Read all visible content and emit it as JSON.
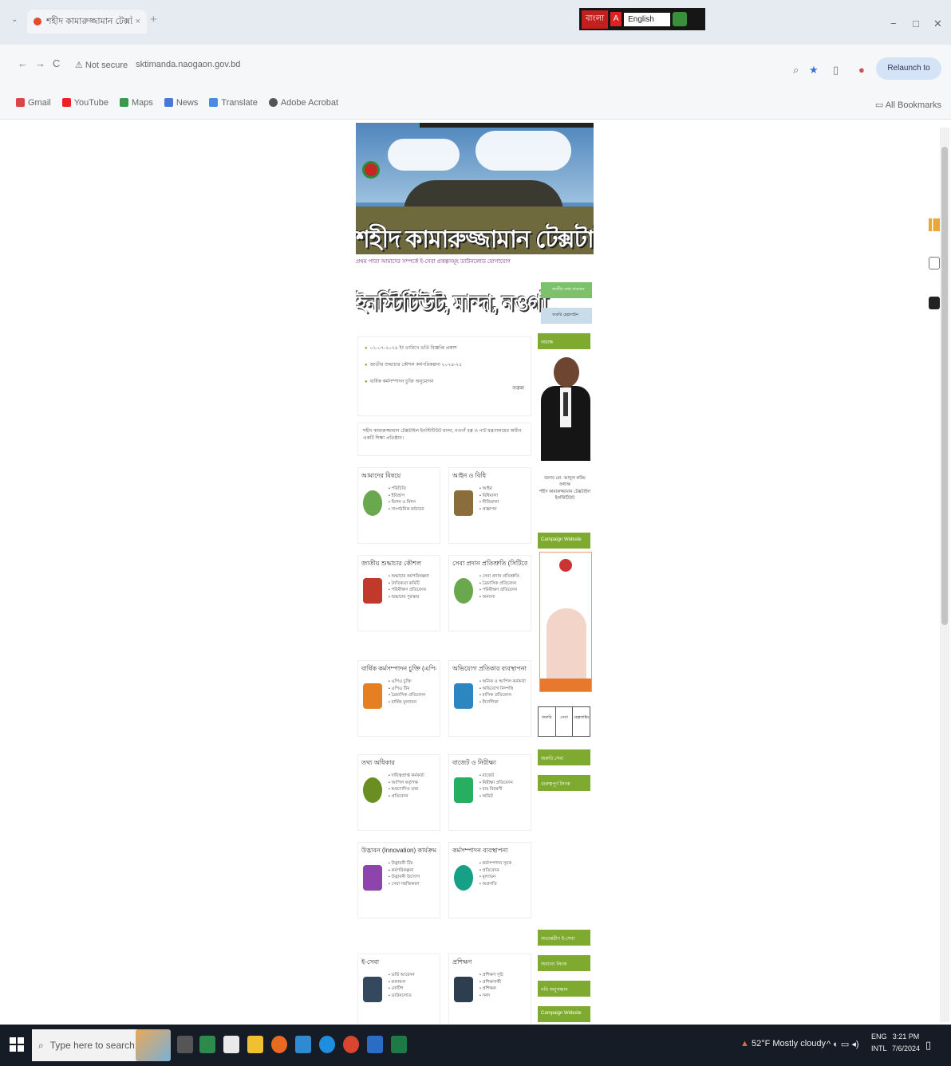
{
  "browser": {
    "tab_title": "শহীদ কামারুজ্জামান টেক্সটাইল",
    "tab_close": "×",
    "new_tab": "+",
    "tab_menu": "⌄",
    "lang_bar": {
      "bangla": "বাংলা",
      "english": "English"
    },
    "window_controls": [
      "−",
      "□",
      "✕"
    ],
    "nav": {
      "back": "←",
      "forward": "→",
      "reload": "C"
    },
    "security": "⚠ Not secure",
    "url": "sktimanda.naogaon.gov.bd",
    "relaunch": "Relaunch to update",
    "bookmarks": [
      "Gmail",
      "YouTube",
      "Maps",
      "News",
      "Translate",
      "Adobe Acrobat"
    ],
    "all_bookmarks": "All Bookmarks"
  },
  "site": {
    "banner_title": "শহীদ কামারুজ্জামান টেক্সটাইল",
    "menu": "প্রথম পাতা  আমাদের সম্পর্কে  ই-সেবা  প্রকল্পসমূহ  ডাউনলোড  যোগাযোগ",
    "subtitle": "ইনস্টিটিউট, মান্দা, নওগাঁ",
    "notices": [
      "০১-০৭-২০২৪ ইং তারিখে ভর্তি বিজ্ঞপ্তি প্রকাশ",
      "জাতীয় শুদ্ধাচার কৌশল কর্মপরিকল্পনা ২০২৪-২৫",
      "বার্ষিক কর্মসম্পাদন চুক্তি অনুমোদন"
    ],
    "notice_more": "সকল",
    "info_text": "শহীদ কামারুজ্জামান টেক্সটাইল ইনস্টিটিউট মান্দা, নওগাঁ বস্ত্র ও পাট মন্ত্রণালয়ের অধীন একটি শিক্ষা প্রতিষ্ঠান।",
    "services": [
      {
        "title": "আমাদের বিষয়ে",
        "items": [
          "পরিচিতি",
          "ইতিহাস",
          "ভিশন ও মিশন",
          "সাংগঠনিক কাঠামো"
        ]
      },
      {
        "title": "আইন ও বিধি",
        "items": [
          "আইন",
          "বিধিমালা",
          "নীতিমালা",
          "প্রজ্ঞাপন"
        ]
      },
      {
        "title": "জাতীয় শুদ্ধাচার কৌশল",
        "items": [
          "শুদ্ধাচার কর্মপরিকল্পনা",
          "নৈতিকতা কমিটি",
          "পরিবীক্ষণ প্রতিবেদন",
          "শুদ্ধাচার পুরস্কার"
        ]
      },
      {
        "title": "সেবা প্রদান প্রতিশ্রুতি (সিটিজেন চার্টার)",
        "items": [
          "সেবা প্রদান প্রতিশ্রুতি",
          "ত্রৈমাসিক প্রতিবেদন",
          "পরিবীক্ষণ প্রতিবেদন",
          "অন্যান্য"
        ]
      },
      {
        "title": "বার্ষিক কর্মসম্পাদন চুক্তি (এপিএ)",
        "items": [
          "এপিএ চুক্তি",
          "এপিএ টিম",
          "ত্রৈমাসিক প্রতিবেদন",
          "বার্ষিক মূল্যায়ন"
        ]
      },
      {
        "title": "অভিযোগ প্রতিকার ব্যবস্থাপনা",
        "items": [
          "অনিক ও আপিল কর্মকর্তা",
          "অভিযোগ নিষ্পত্তি",
          "মাসিক প্রতিবেদন",
          "নির্দেশিকা"
        ]
      },
      {
        "title": "তথ্য অধিকার",
        "items": [
          "দায়িত্বপ্রাপ্ত কর্মকর্তা",
          "আপিল কর্তৃপক্ষ",
          "স্বপ্রণোদিত তথ্য",
          "প্রতিবেদন"
        ]
      },
      {
        "title": "বাজেট ও নিরীক্ষা",
        "items": [
          "বাজেট",
          "নিরীক্ষা প্রতিবেদন",
          "ব্যয় বিবরণী",
          "অডিট"
        ]
      },
      {
        "title": "উদ্ভাবন (Innovation) কার্যক্রম",
        "items": [
          "উদ্ভাবনী টিম",
          "কর্মপরিকল্পনা",
          "উদ্ভাবনী উদ্যোগ",
          "সেবা সহজিকরণ"
        ]
      },
      {
        "title": "কর্মসম্পাদন ব্যবস্থাপনা",
        "items": [
          "কর্মসম্পাদন সূচক",
          "প্রতিবেদন",
          "মূল্যায়ন",
          "অগ্রগতি"
        ]
      },
      {
        "title": "ই-সেবা",
        "items": [
          "ভর্তি আবেদন",
          "ফলাফল",
          "নোটিশ",
          "ডাউনলোড"
        ]
      },
      {
        "title": "প্রশিক্ষণ",
        "items": [
          "প্রশিক্ষণ সূচি",
          "প্রশিক্ষণার্থী",
          "প্রশিক্ষক",
          "সনদ"
        ]
      }
    ],
    "sidebar": {
      "tile1": "জাতীয় তথ্য বাতায়ন",
      "tile2": "জরুরি হেল্পলাইন",
      "btn_top": "অধ্যক্ষ",
      "caption": "জনাব মো. আব্দুল করিম\nঅধ্যক্ষ\nশহীদ কামারুজ্জামান টেক্সটাইল ইনস্টিটিউট",
      "btn_campaign": "Campaign Website",
      "minibox": [
        "জরুরি",
        "সেবা",
        "হেল্পলাইন"
      ],
      "btn_1": "জরুরি সেবা",
      "btn_2": "গুরুত্বপূর্ণ লিংক",
      "btn_3": "অভ্যন্তরীণ ই-সেবা",
      "btn_4": "অন্যান্য লিংক",
      "btn_5": "নথি অনুসন্ধান",
      "btn_6": "Campaign Website"
    }
  },
  "taskbar": {
    "search_placeholder": "Type here to search",
    "weather": "52°F  Mostly cloudy",
    "lang_top": "ENG",
    "lang_bottom": "INTL",
    "time": "3:21 PM",
    "date": "7/6/2024"
  },
  "colors": {
    "accent_green": "#7daa2f",
    "taskbar": "#151c26",
    "chrome_tab": "#e6ebf1"
  }
}
